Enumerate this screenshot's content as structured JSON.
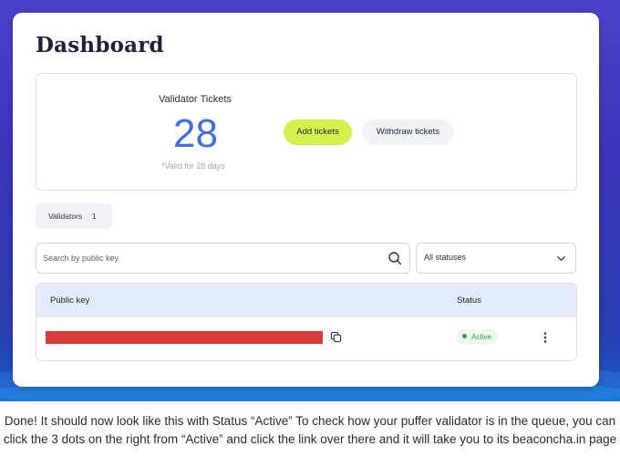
{
  "dashboard": {
    "title": "Dashboard",
    "tickets": {
      "label": "Validator Tickets",
      "count": "28",
      "note": "*Valid for 28 days",
      "add_label": "Add tickets",
      "withdraw_label": "Withdraw tickets"
    },
    "validators_tab": {
      "label": "Validators",
      "count": "1"
    },
    "search": {
      "placeholder": "Search by public key",
      "value": ""
    },
    "status_filter": {
      "selected": "All statuses"
    },
    "table": {
      "columns": [
        "Public key",
        "Status"
      ],
      "rows": [
        {
          "public_key": "",
          "status": "Active"
        }
      ]
    }
  },
  "icons": [
    "search-icon",
    "chevron-down-icon",
    "copy-icon",
    "more-vertical-icon"
  ],
  "colors": {
    "accent_button": "#d4f04a",
    "ticket_count": "#3d6ee6",
    "status_active": "#2e9e48",
    "redaction": "#d93a3a",
    "background_gradient_top": "#4a43c8"
  },
  "caption": "Done! It should now look like this with Status “Active” To check how your puffer validator is in the queue, you can click the 3 dots on the right from “Active” and click the link over there and it will take you to its beaconcha.in page"
}
